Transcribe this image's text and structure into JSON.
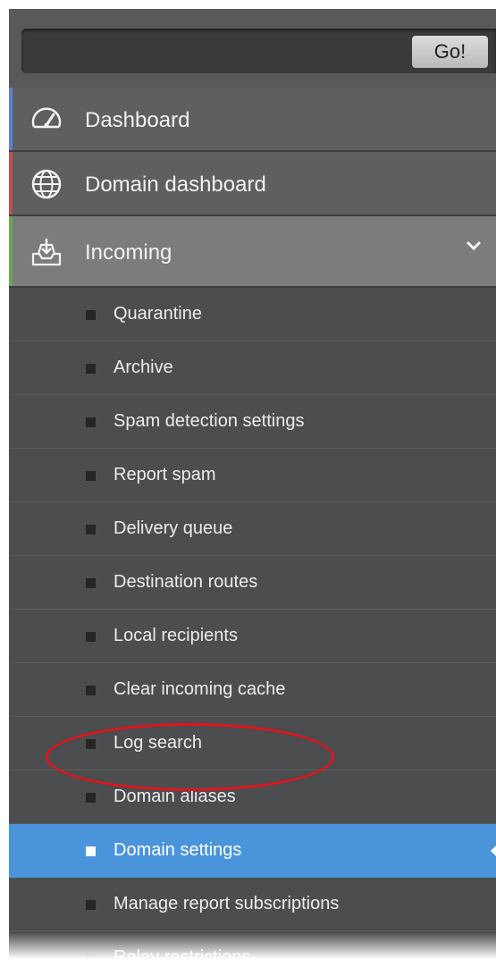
{
  "search": {
    "placeholder": "",
    "value": "",
    "go_label": "Go!"
  },
  "menu": {
    "items": [
      {
        "label": "Dashboard",
        "icon": "dashboard-gauge-icon",
        "accent": "#5b7fd4"
      },
      {
        "label": "Domain dashboard",
        "icon": "globe-icon",
        "accent": "#c0504d"
      },
      {
        "label": "Incoming",
        "icon": "inbox-download-icon",
        "accent": "#6aa84f",
        "expanded": true
      }
    ]
  },
  "submenu": {
    "items": [
      {
        "label": "Quarantine"
      },
      {
        "label": "Archive"
      },
      {
        "label": "Spam detection settings"
      },
      {
        "label": "Report spam"
      },
      {
        "label": "Delivery queue"
      },
      {
        "label": "Destination routes"
      },
      {
        "label": "Local recipients"
      },
      {
        "label": "Clear incoming cache"
      },
      {
        "label": "Log search"
      },
      {
        "label": "Domain aliases"
      },
      {
        "label": "Domain settings",
        "active": true
      },
      {
        "label": "Manage report subscriptions"
      },
      {
        "label": "Relay restrictions"
      }
    ]
  },
  "colors": {
    "panel": "#4c4d4f",
    "active": "#4a94db",
    "highlight_ellipse": "#e3131b"
  }
}
